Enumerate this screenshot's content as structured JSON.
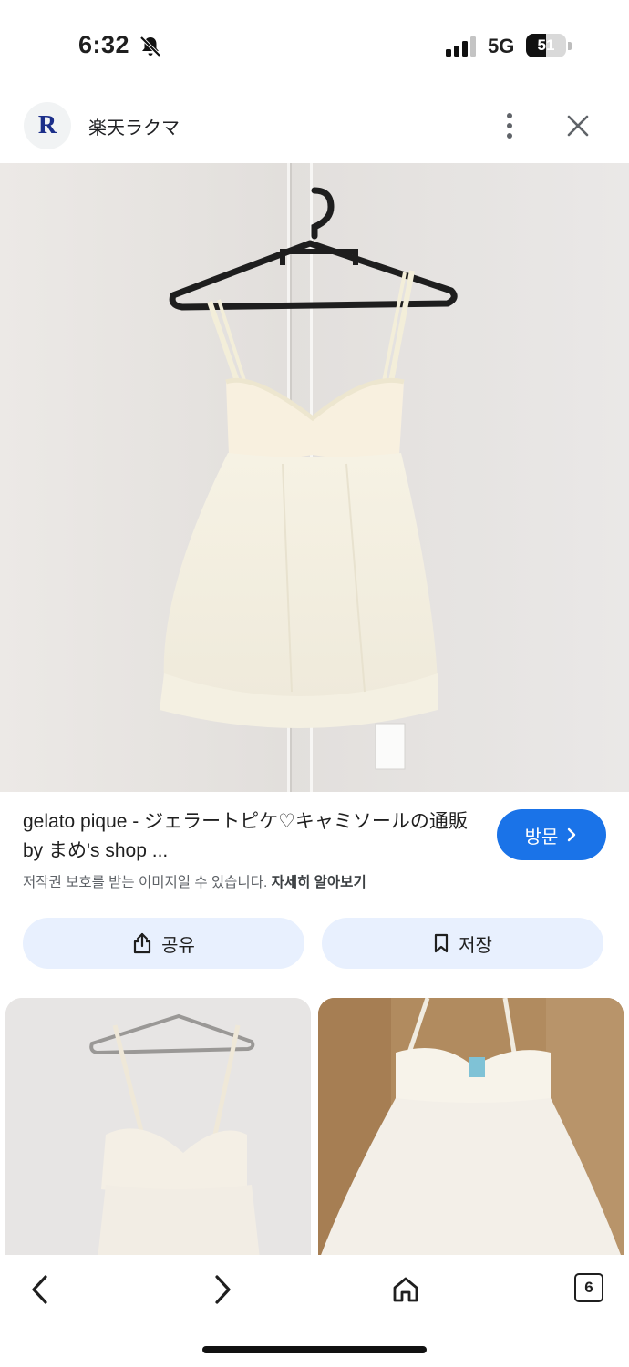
{
  "status_bar": {
    "time": "6:32",
    "network": "5G",
    "battery_level": 51,
    "battery_text": "51"
  },
  "header": {
    "logo_letter": "R",
    "site_name": "楽天ラクマ"
  },
  "result": {
    "title": "gelato pique - ジェラートピケ♡キャミソールの通販 by まめ's shop ...",
    "visit_label": "방문",
    "copyright_notice": "저작권 보호를 받는 이미지일 수 있습니다.",
    "learn_more": "자세히 알아보기"
  },
  "actions": {
    "share_label": "공유",
    "save_label": "저장"
  },
  "bottom_nav": {
    "tab_count": "6"
  },
  "icons": [
    "bell-muted-icon",
    "signal-icon",
    "battery-icon",
    "more-vertical-icon",
    "close-icon",
    "chevron-right-icon",
    "share-icon",
    "bookmark-icon",
    "back-icon",
    "forward-icon",
    "home-icon",
    "tabs-icon"
  ]
}
